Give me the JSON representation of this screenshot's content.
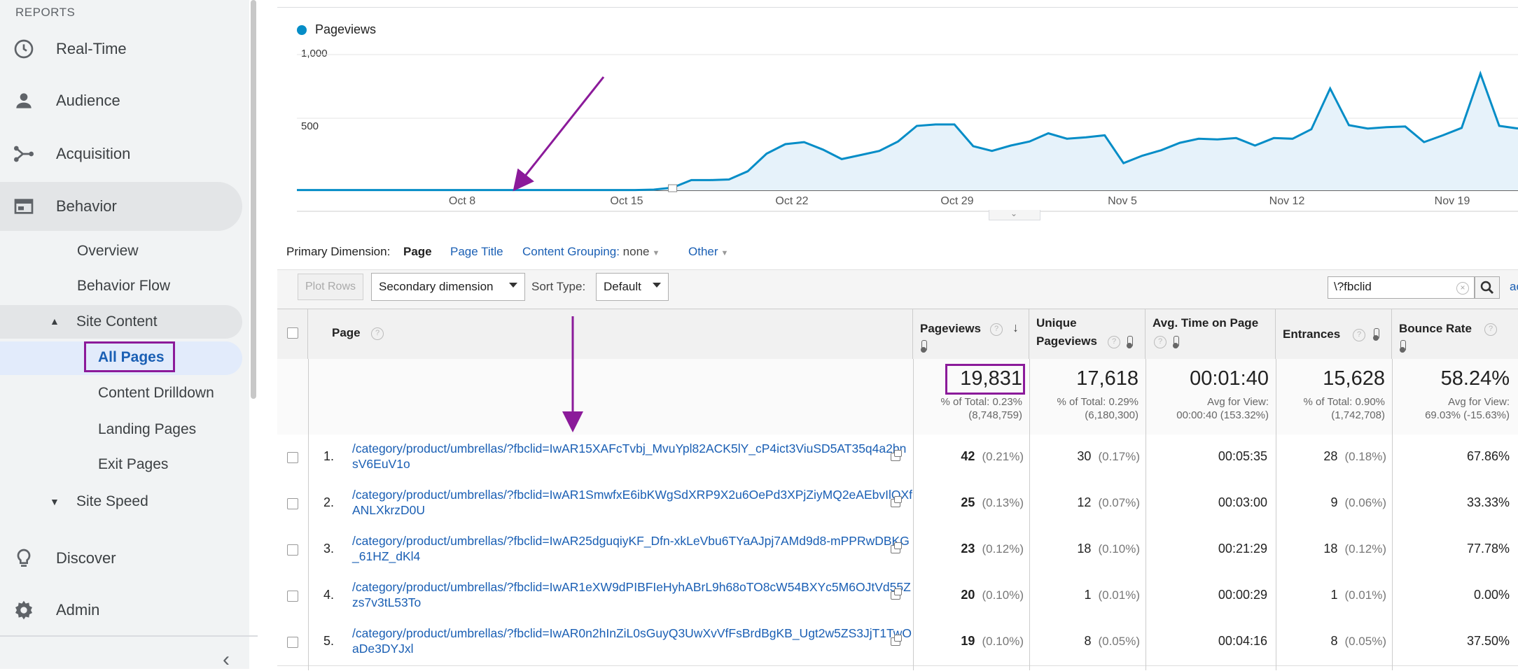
{
  "sidebar": {
    "section_label": "REPORTS",
    "items": [
      {
        "label": "Real-Time",
        "icon": "clock-icon"
      },
      {
        "label": "Audience",
        "icon": "person-icon"
      },
      {
        "label": "Acquisition",
        "icon": "acquisition-icon"
      },
      {
        "label": "Behavior",
        "icon": "behavior-icon"
      },
      {
        "label": "Discover",
        "icon": "lightbulb-icon"
      },
      {
        "label": "Admin",
        "icon": "gear-icon"
      }
    ],
    "behavior_sub": {
      "overview": "Overview",
      "behavior_flow": "Behavior Flow",
      "site_content": "Site Content",
      "all_pages": "All Pages",
      "content_drilldown": "Content Drilldown",
      "landing_pages": "Landing Pages",
      "exit_pages": "Exit Pages",
      "site_speed": "Site Speed"
    }
  },
  "chart": {
    "legend": "Pageviews"
  },
  "chart_data": {
    "type": "area",
    "series": [
      {
        "name": "Pageviews",
        "color": "#058dc7",
        "values": [
          2,
          2,
          2,
          2,
          2,
          2,
          2,
          2,
          2,
          2,
          2,
          2,
          2,
          2,
          2,
          2,
          2,
          2,
          2,
          5,
          20,
          75,
          75,
          80,
          140,
          270,
          340,
          355,
          300,
          230,
          260,
          290,
          360,
          475,
          485,
          485,
          325,
          290,
          330,
          360,
          420,
          380,
          390,
          405,
          200,
          255,
          295,
          350,
          380,
          375,
          385,
          330,
          385,
          380,
          450,
          750,
          480,
          455,
          465,
          470,
          355,
          405,
          460,
          860,
          475,
          455
        ]
      }
    ],
    "x_tick_labels": [
      "Oct 8",
      "Oct 15",
      "Oct 22",
      "Oct 29",
      "Nov 5",
      "Nov 12",
      "Nov 19"
    ],
    "y_tick_labels": [
      "1,000",
      "500"
    ],
    "ylim": [
      0,
      1000
    ],
    "grid": true
  },
  "primary_dimension": {
    "label": "Primary Dimension:",
    "page": "Page",
    "page_title": "Page Title",
    "content_grouping": "Content Grouping:",
    "content_grouping_value": "none",
    "other": "Other"
  },
  "toolbar": {
    "plot_rows": "Plot Rows",
    "secondary_dimension": "Secondary dimension",
    "sort_type_label": "Sort Type:",
    "sort_type_value": "Default",
    "search_value": "\\?fbclid",
    "advanced": "ac"
  },
  "table": {
    "headers": {
      "page": "Page",
      "pageviews": "Pageviews",
      "unique_pageviews_1": "Unique",
      "unique_pageviews_2": "Pageviews",
      "avg_time": "Avg. Time on Page",
      "entrances": "Entrances",
      "bounce_rate": "Bounce Rate"
    },
    "totals": {
      "pageviews": "19,831",
      "pageviews_sub1": "% of Total: 0.23%",
      "pageviews_sub2": "(8,748,759)",
      "unique": "17,618",
      "unique_sub1": "% of Total: 0.29%",
      "unique_sub2": "(6,180,300)",
      "avg_time": "00:01:40",
      "avg_time_sub1": "Avg for View:",
      "avg_time_sub2": "00:00:40 (153.32%)",
      "entrances": "15,628",
      "entrances_sub1": "% of Total: 0.90%",
      "entrances_sub2": "(1,742,708)",
      "bounce": "58.24%",
      "bounce_sub1": "Avg for View:",
      "bounce_sub2": "69.03% (-15.63%)"
    },
    "rows": [
      {
        "num": "1.",
        "page": "/category/product/umbrellas/?fbclid=IwAR15XAFcTvbj_MvuYpl82ACK5lY_cP4ict3ViuSD5AT35q4a2bnsV6EuV1o",
        "pv": "42",
        "pv_pct": "(0.21%)",
        "upv": "30",
        "upv_pct": "(0.17%)",
        "time": "00:05:35",
        "ent": "28",
        "ent_pct": "(0.18%)",
        "bounce": "67.86%"
      },
      {
        "num": "2.",
        "page": "/category/product/umbrellas/?fbclid=IwAR1SmwfxE6ibKWgSdXRP9X2u6OePd3XPjZiyMQ2eAEbvIlQXfANLXkrzD0U",
        "pv": "25",
        "pv_pct": "(0.13%)",
        "upv": "12",
        "upv_pct": "(0.07%)",
        "time": "00:03:00",
        "ent": "9",
        "ent_pct": "(0.06%)",
        "bounce": "33.33%"
      },
      {
        "num": "3.",
        "page": "/category/product/umbrellas/?fbclid=IwAR25dguqiyKF_Dfn-xkLeVbu6TYaAJpj7AMd9d8-mPPRwDBKG_61HZ_dKl4",
        "pv": "23",
        "pv_pct": "(0.12%)",
        "upv": "18",
        "upv_pct": "(0.10%)",
        "time": "00:21:29",
        "ent": "18",
        "ent_pct": "(0.12%)",
        "bounce": "77.78%"
      },
      {
        "num": "4.",
        "page": "/category/product/umbrellas/?fbclid=IwAR1eXW9dPIBFIeHyhABrL9h68oTO8cW54BXYc5M6OJtVd55Zzs7v3tL53To",
        "pv": "20",
        "pv_pct": "(0.10%)",
        "upv": "1",
        "upv_pct": "(0.01%)",
        "time": "00:00:29",
        "ent": "1",
        "ent_pct": "(0.01%)",
        "bounce": "0.00%"
      },
      {
        "num": "5.",
        "page": "/category/product/umbrellas/?fbclid=IwAR0n2hInZiL0sGuyQ3UwXvVfFsBrdBgKB_Ugt2w5ZS3JjT1TwOaDe3DYJxl",
        "pv": "19",
        "pv_pct": "(0.10%)",
        "upv": "8",
        "upv_pct": "(0.05%)",
        "time": "00:04:16",
        "ent": "8",
        "ent_pct": "(0.05%)",
        "bounce": "37.50%"
      }
    ]
  }
}
